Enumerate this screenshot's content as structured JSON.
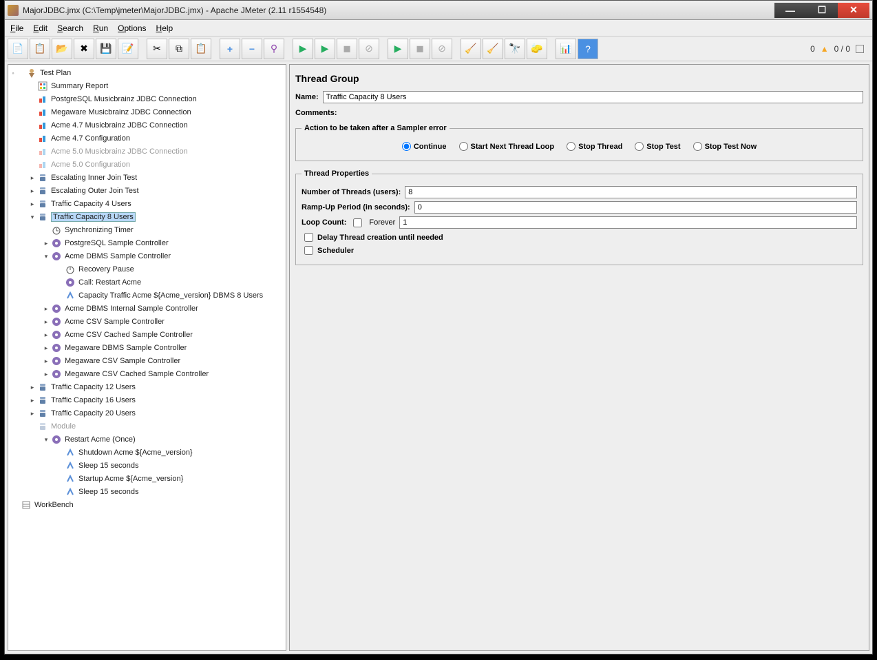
{
  "window": {
    "title": "MajorJDBC.jmx (C:\\Temp\\jmeter\\MajorJDBC.jmx) - Apache JMeter (2.11 r1554548)"
  },
  "menu": {
    "file": "File",
    "edit": "Edit",
    "search": "Search",
    "run": "Run",
    "options": "Options",
    "help": "Help"
  },
  "status": {
    "zero": "0",
    "ratio": "0 / 0"
  },
  "tree": {
    "testplan": "Test Plan",
    "summary": "Summary Report",
    "pg_conn": "PostgreSQL Musicbrainz JDBC Connection",
    "mw_conn": "Megaware Musicbrainz JDBC Connection",
    "a47_conn": "Acme 4.7 Musicbrainz JDBC Connection",
    "a47_cfg": "Acme 4.7 Configuration",
    "a50_conn": "Acme 5.0 Musicbrainz JDBC Connection",
    "a50_cfg": "Acme 5.0 Configuration",
    "esc_inner": "Escalating Inner Join Test",
    "esc_outer": "Escalating Outer Join Test",
    "tc4": "Traffic Capacity 4 Users",
    "tc8": "Traffic Capacity 8 Users",
    "sync_timer": "Synchronizing Timer",
    "pg_sc": "PostgreSQL Sample Controller",
    "acme_sc": "Acme DBMS Sample Controller",
    "recovery": "Recovery Pause",
    "call_restart": "Call: Restart Acme",
    "cap_traffic": "Capacity Traffic Acme ${Acme_version} DBMS 8 Users",
    "acme_internal": "Acme DBMS Internal Sample Controller",
    "acme_csv": "Acme CSV Sample Controller",
    "acme_csv_cached": "Acme CSV Cached Sample Controller",
    "mw_dbms": "Megaware DBMS Sample Controller",
    "mw_csv": "Megaware CSV Sample Controller",
    "mw_csv_cached": "Megaware CSV Cached Sample Controller",
    "tc12": "Traffic Capacity 12 Users",
    "tc16": "Traffic Capacity 16 Users",
    "tc20": "Traffic Capacity 20 Users",
    "module": "Module",
    "restart_once": "Restart Acme (Once)",
    "shutdown": "Shutdown Acme ${Acme_version}",
    "sleep1": "Sleep 15 seconds",
    "startup": "Startup Acme ${Acme_version}",
    "sleep2": "Sleep 15 seconds",
    "workbench": "WorkBench"
  },
  "panel": {
    "title": "Thread Group",
    "name_label": "Name:",
    "name_value": "Traffic Capacity 8 Users",
    "comments_label": "Comments:",
    "action_legend": "Action to be taken after a Sampler error",
    "radio_continue": "Continue",
    "radio_next": "Start Next Thread Loop",
    "radio_stopthread": "Stop Thread",
    "radio_stoptest": "Stop Test",
    "radio_stopnow": "Stop Test Now",
    "thread_legend": "Thread Properties",
    "num_threads_label": "Number of Threads (users):",
    "num_threads_value": "8",
    "rampup_label": "Ramp-Up Period (in seconds):",
    "rampup_value": "0",
    "loop_label": "Loop Count:",
    "forever_label": "Forever",
    "loop_value": "1",
    "delay_label": "Delay Thread creation until needed",
    "scheduler_label": "Scheduler"
  }
}
